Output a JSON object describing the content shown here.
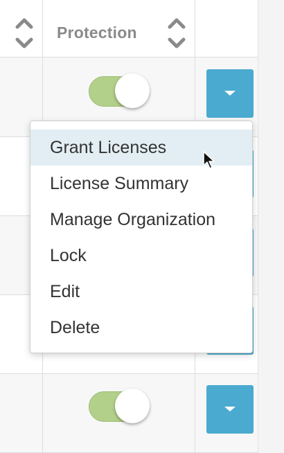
{
  "table": {
    "header": {
      "protection_label": "Protection"
    },
    "rows": [
      {
        "protection_enabled": true
      },
      {
        "protection_enabled": true
      }
    ]
  },
  "dropdown_menu": {
    "items": [
      {
        "label": "Grant Licenses",
        "highlighted": true
      },
      {
        "label": "License Summary"
      },
      {
        "label": "Manage Organization"
      },
      {
        "label": "Lock"
      },
      {
        "label": "Edit"
      },
      {
        "label": "Delete"
      }
    ]
  },
  "colors": {
    "toggle_on": "#b2d08a",
    "action_button": "#4aaacf",
    "menu_highlight": "#e2eef3",
    "header_text": "#8a8a8a"
  },
  "icons": {
    "sort": "sort-up-down-icon",
    "action_caret": "caret-down-icon",
    "cursor": "mouse-pointer-icon"
  }
}
